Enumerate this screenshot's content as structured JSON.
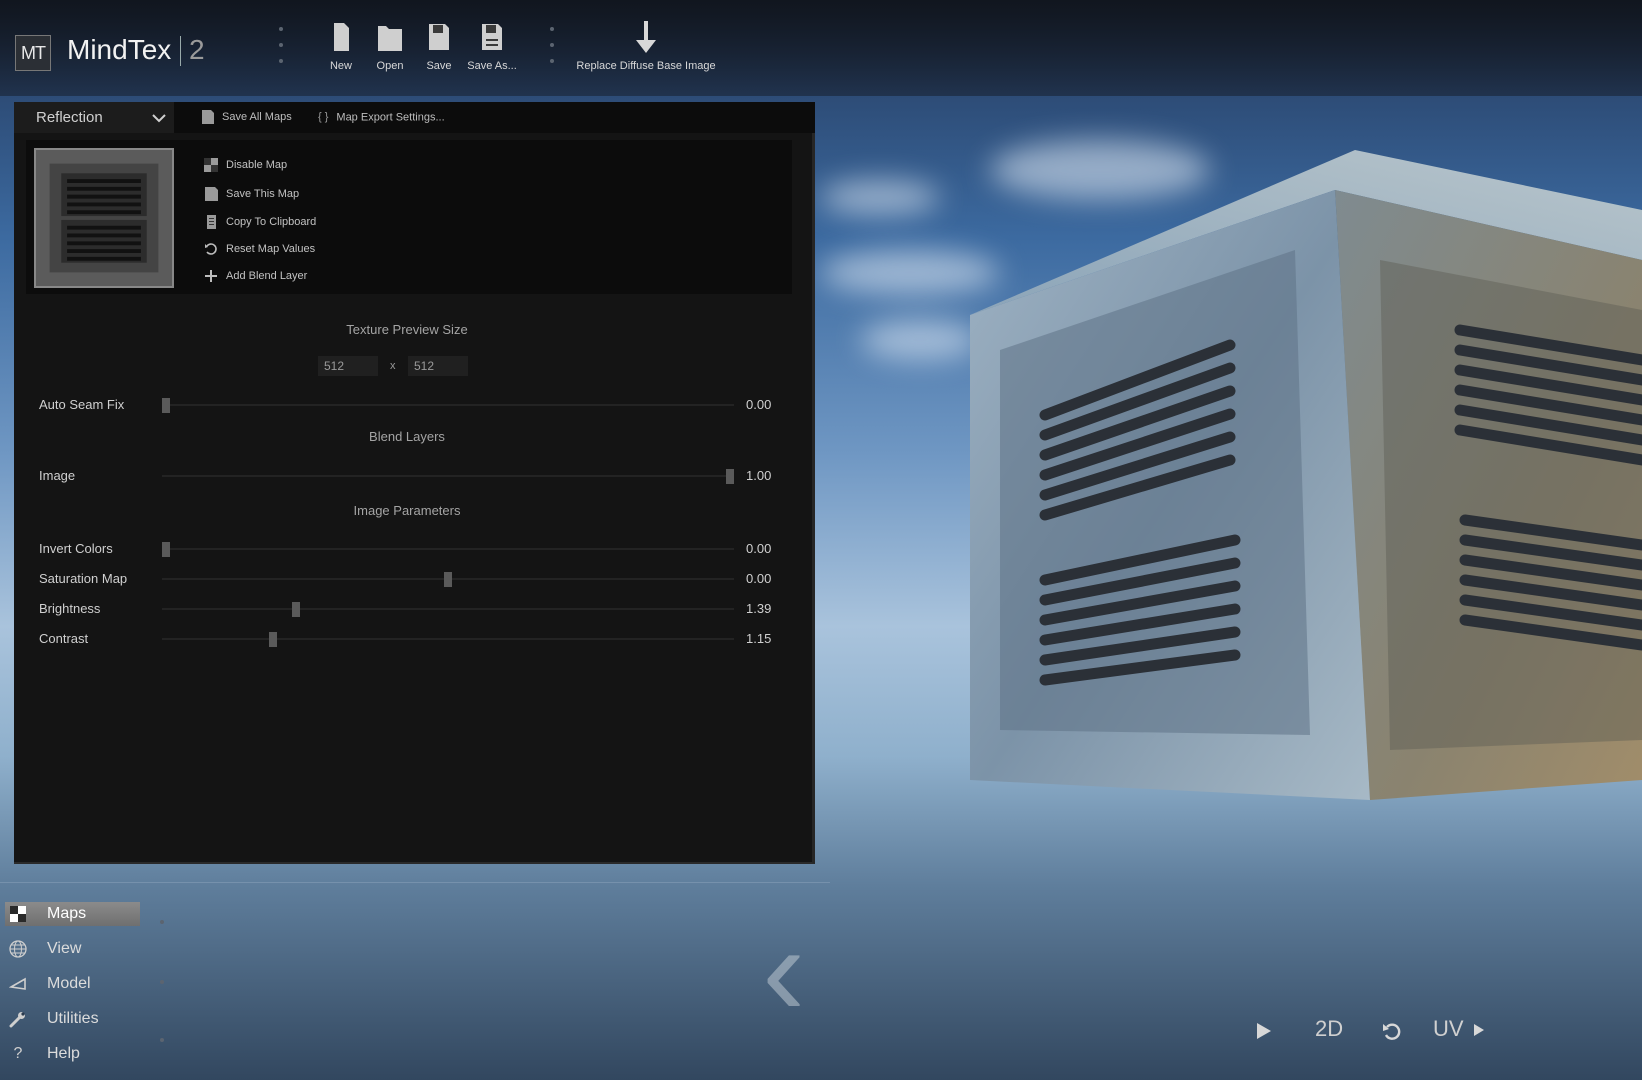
{
  "app": {
    "logo": "MT",
    "name": "MindTex",
    "version": "2"
  },
  "toolbar": {
    "new_label": "New",
    "open_label": "Open",
    "save_label": "Save",
    "save_as_label": "Save As...",
    "replace_label": "Replace Diffuse Base Image"
  },
  "panel": {
    "map_select": "Reflection",
    "save_all_label": "Save All Maps",
    "export_settings_label": "Map Export Settings...",
    "export_settings_icon": "{ }",
    "actions": {
      "disable": "Disable Map",
      "save_this": "Save This Map",
      "copy": "Copy To Clipboard",
      "reset": "Reset Map Values",
      "add_blend": "Add Blend Layer"
    },
    "texture_preview_title": "Texture Preview Size",
    "preview_width": "512",
    "preview_x": "x",
    "preview_height": "512",
    "blend_layers_title": "Blend Layers",
    "image_params_title": "Image Parameters",
    "params": {
      "auto_seam": {
        "label": "Auto Seam Fix",
        "value": "0.00",
        "level": 0.0
      },
      "image": {
        "label": "Image",
        "value": "1.00",
        "level": 1.0
      },
      "invert": {
        "label": "Invert Colors",
        "value": "0.00",
        "level": 0.0
      },
      "saturation": {
        "label": "Saturation Map",
        "value": "0.00",
        "level": 0.5
      },
      "brightness": {
        "label": "Brightness",
        "value": "1.39",
        "level": 0.23
      },
      "contrast": {
        "label": "Contrast",
        "value": "1.15",
        "level": 0.19
      }
    }
  },
  "nav": {
    "maps": "Maps",
    "view": "View",
    "model": "Model",
    "utilities": "Utilities",
    "help": "Help",
    "help_icon": "?"
  },
  "viewport": {
    "mode_2d": "2D",
    "uv_label": "UV",
    "back_chevron": "‹"
  },
  "icons": {
    "new": "file-icon",
    "open": "folder-icon",
    "save": "floppy-icon",
    "save_as": "floppy-as-icon",
    "replace": "arrow-down-icon",
    "maps": "checker-icon",
    "view": "globe-icon",
    "model": "model-icon",
    "utilities": "wrench-icon",
    "help": "question-icon",
    "play": "play-icon",
    "reset_view": "rotate-icon"
  },
  "colors": {
    "panel_bg": "#141414",
    "active_nav": "#808080",
    "sky_top": "#2c4a74",
    "sky_horizon": "#a9c3dc"
  }
}
